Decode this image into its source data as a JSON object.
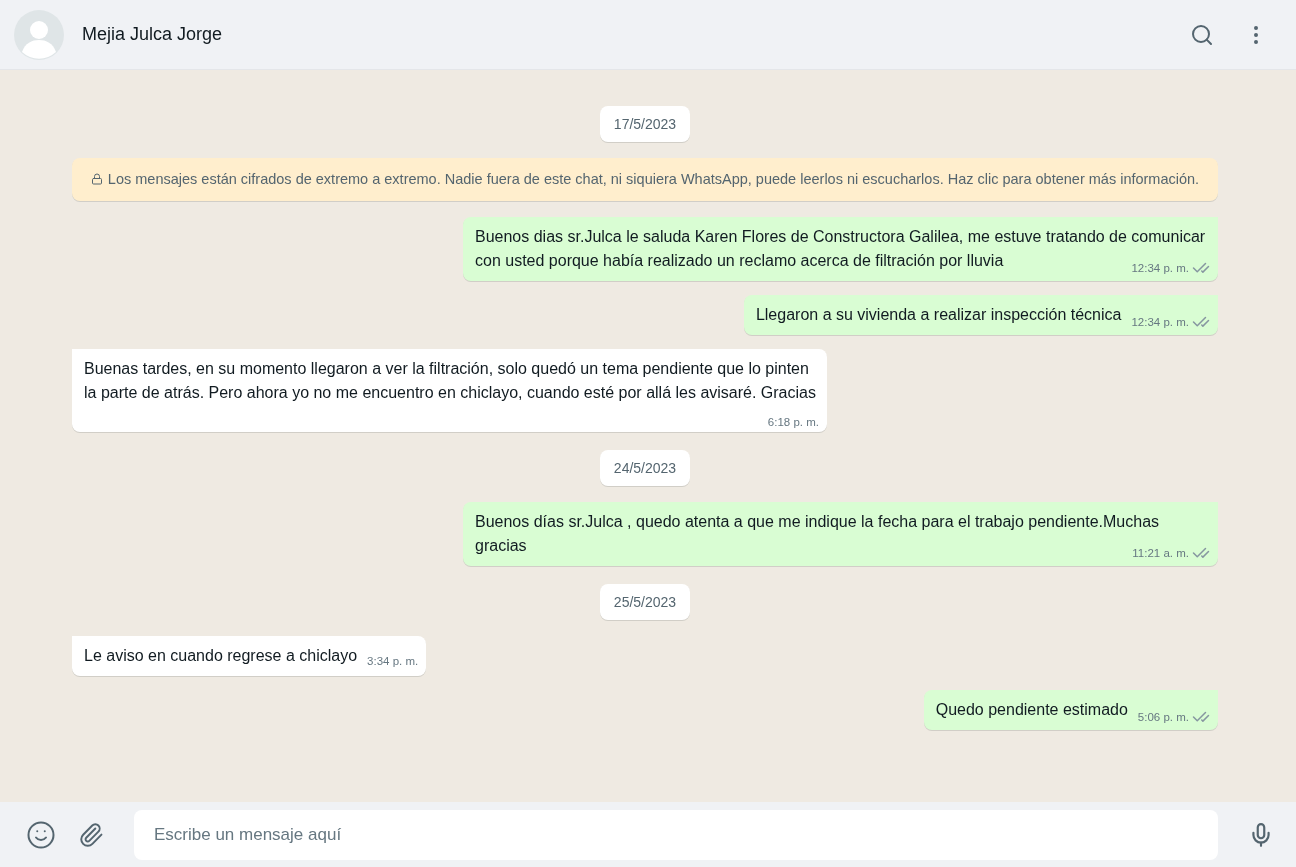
{
  "header": {
    "contact_name": "Mejia Julca Jorge"
  },
  "chat": [
    {
      "kind": "date",
      "text": "17/5/2023"
    },
    {
      "kind": "notice",
      "text": "Los mensajes están cifrados de extremo a extremo. Nadie fuera de este chat, ni siquiera WhatsApp, puede leerlos ni escucharlos. Haz clic para obtener más información."
    },
    {
      "kind": "message",
      "outgoing": true,
      "text": "Buenos dias sr.Julca le saluda Karen Flores de Constructora Galilea, me estuve tratando de comunicar con usted porque había realizado un reclamo acerca de filtración por lluvia",
      "time": "12:34 p. m.",
      "read": false
    },
    {
      "kind": "message",
      "outgoing": true,
      "text": "Llegaron a su vivienda a realizar inspección técnica",
      "time": "12:34 p. m.",
      "read": false
    },
    {
      "kind": "message",
      "outgoing": false,
      "text": "Buenas tardes, en su momento llegaron a ver la filtración, solo quedó un tema pendiente que lo pinten la parte de atrás. Pero ahora yo no me encuentro en chiclayo, cuando esté por allá les avisaré. Gracias",
      "time": "6:18 p. m."
    },
    {
      "kind": "date",
      "text": "24/5/2023"
    },
    {
      "kind": "message",
      "outgoing": true,
      "text": "Buenos días sr.Julca , quedo atenta a que me indique la fecha para el trabajo pendiente.Muchas gracias",
      "time": "11:21 a. m.",
      "read": false
    },
    {
      "kind": "date",
      "text": "25/5/2023"
    },
    {
      "kind": "message",
      "outgoing": false,
      "text": "Le aviso en cuando regrese a chiclayo",
      "time": "3:34 p. m."
    },
    {
      "kind": "message",
      "outgoing": true,
      "text": "Quedo pendiente estimado",
      "time": "5:06 p. m.",
      "read": false
    }
  ],
  "composer": {
    "placeholder": "Escribe un mensaje aquí"
  }
}
